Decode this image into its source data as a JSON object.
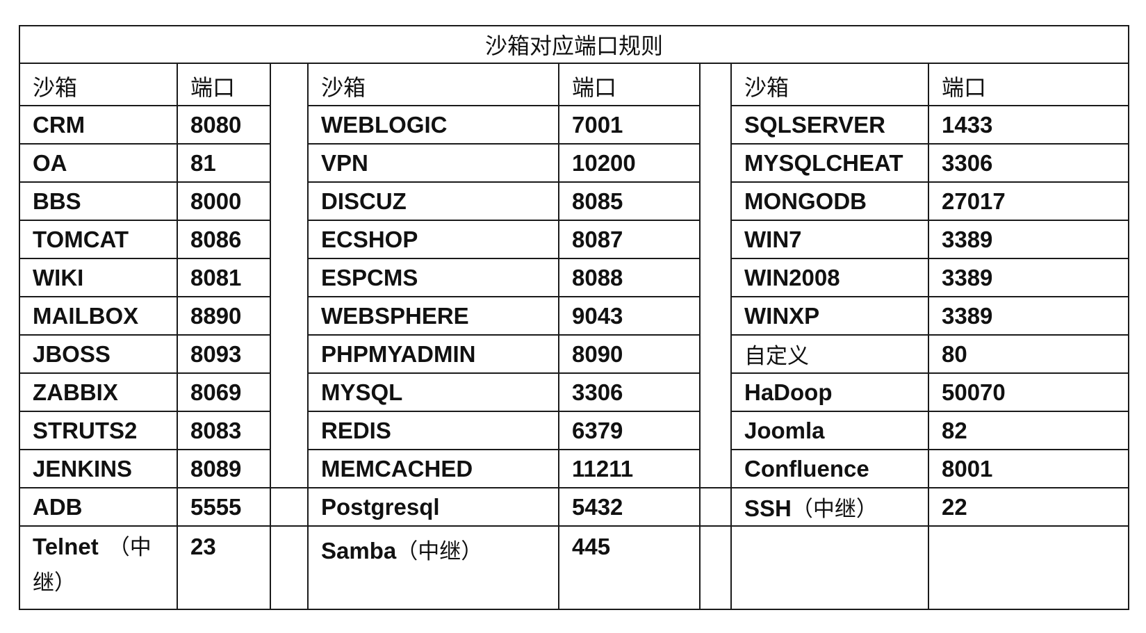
{
  "title": "沙箱对应端口规则",
  "headers": {
    "sandbox": "沙箱",
    "port": "端口"
  },
  "rows": [
    [
      {
        "name": "CRM",
        "port": "8080"
      },
      {
        "name": "WEBLOGIC",
        "port": "7001"
      },
      {
        "name": "SQLSERVER",
        "port": "1433"
      }
    ],
    [
      {
        "name": "OA",
        "port": "81"
      },
      {
        "name": "VPN",
        "port": "10200"
      },
      {
        "name": "MYSQLCHEAT",
        "port": "3306"
      }
    ],
    [
      {
        "name": "BBS",
        "port": "8000"
      },
      {
        "name": "DISCUZ",
        "port": "8085"
      },
      {
        "name": "MONGODB",
        "port": "27017"
      }
    ],
    [
      {
        "name": "TOMCAT",
        "port": "8086"
      },
      {
        "name": "ECSHOP",
        "port": "8087"
      },
      {
        "name": "WIN7",
        "port": "3389"
      }
    ],
    [
      {
        "name": "WIKI",
        "port": "8081"
      },
      {
        "name": "ESPCMS",
        "port": "8088"
      },
      {
        "name": "WIN2008",
        "port": "3389"
      }
    ],
    [
      {
        "name": "MAILBOX",
        "port": "8890"
      },
      {
        "name": "WEBSPHERE",
        "port": "9043"
      },
      {
        "name": "WINXP",
        "port": "3389"
      }
    ],
    [
      {
        "name": "JBOSS",
        "port": "8093"
      },
      {
        "name": "PHPMYADMIN",
        "port": "8090"
      },
      {
        "name": "自定义",
        "port": "80"
      }
    ],
    [
      {
        "name": "ZABBIX",
        "port": "8069"
      },
      {
        "name": "MYSQL",
        "port": "3306"
      },
      {
        "name": "HaDoop",
        "port": "50070"
      }
    ],
    [
      {
        "name": "STRUTS2",
        "port": "8083"
      },
      {
        "name": "REDIS",
        "port": "6379"
      },
      {
        "name": "Joomla",
        "port": "82"
      }
    ],
    [
      {
        "name": "JENKINS",
        "port": "8089"
      },
      {
        "name": "MEMCACHED",
        "port": "11211"
      },
      {
        "name": "Confluence",
        "port": "8001"
      }
    ],
    [
      {
        "name": "ADB",
        "port": "5555"
      },
      {
        "name": "Postgresql",
        "port": "5432"
      },
      {
        "name": "SSH",
        "suffix": "（中继）",
        "port": "22"
      }
    ]
  ],
  "last_row": {
    "c1_name": "Telnet",
    "c1_suffix_a": "（中",
    "c1_suffix_b": "继）",
    "c1_port": "23",
    "c2_name": "Samba",
    "c2_suffix": "（中继）",
    "c2_port": "445"
  }
}
